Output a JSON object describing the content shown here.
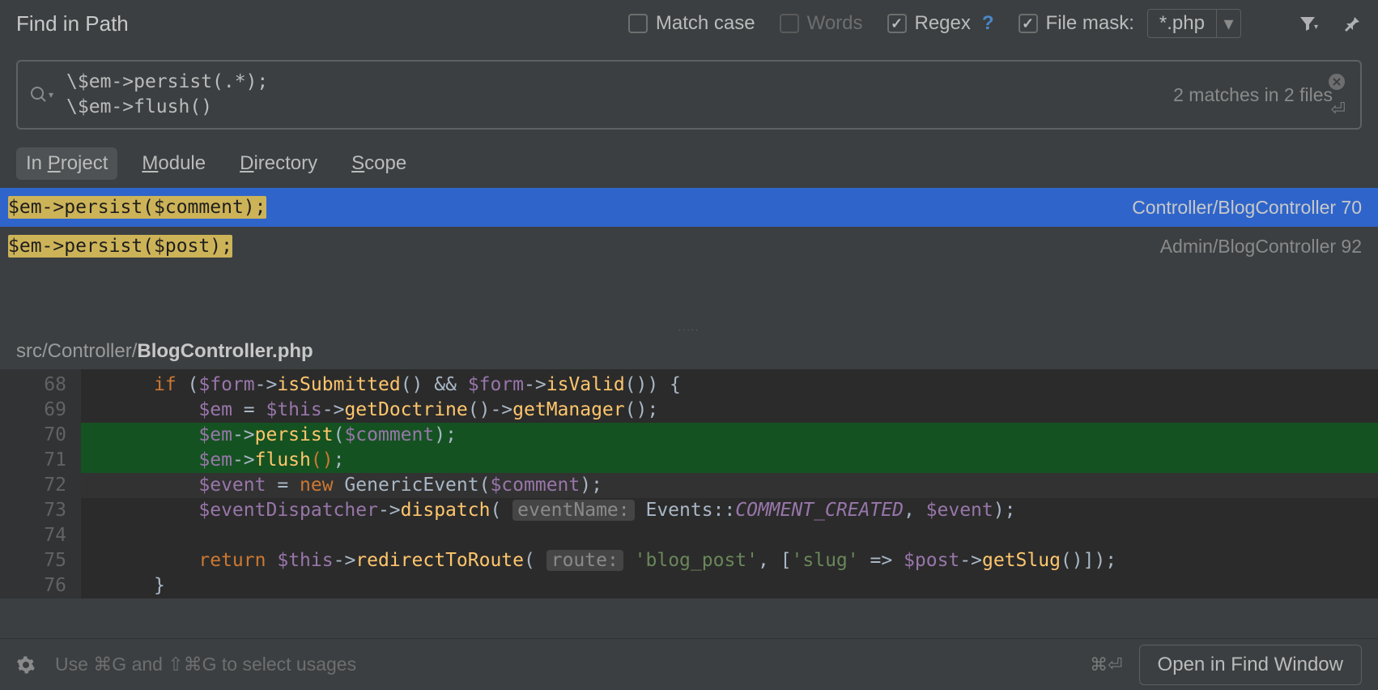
{
  "title": "Find in Path",
  "options": {
    "match_case": "Match case",
    "words": "Words",
    "regex": "Regex",
    "file_mask": "File mask:",
    "file_mask_value": "*.php"
  },
  "search": {
    "line1": "\\$em->persist(.*);",
    "line2": "\\$em->flush()",
    "status": "2 matches in 2 files"
  },
  "scopes": {
    "project": "roject",
    "project_u": "P",
    "module": "odule",
    "module_u": "M",
    "directory": "irectory",
    "directory_u": "D",
    "scope": "cope",
    "scope_u": "S"
  },
  "results": [
    {
      "code": "$em->persist($comment);",
      "loc": "Controller/BlogController 70",
      "selected": true
    },
    {
      "code": "$em->persist($post);",
      "loc": "Admin/BlogController 92",
      "selected": false
    }
  ],
  "preview": {
    "path_prefix": "src/Controller/",
    "path_file": "BlogController.php",
    "gutter": [
      "68",
      "69",
      "70",
      "71",
      "72",
      "73",
      "74",
      "75",
      "76"
    ]
  },
  "footer": {
    "hint": "Use ⌘G and ⇧⌘G to select usages",
    "shortcut": "⌘⏎",
    "button": "Open in Find Window"
  }
}
